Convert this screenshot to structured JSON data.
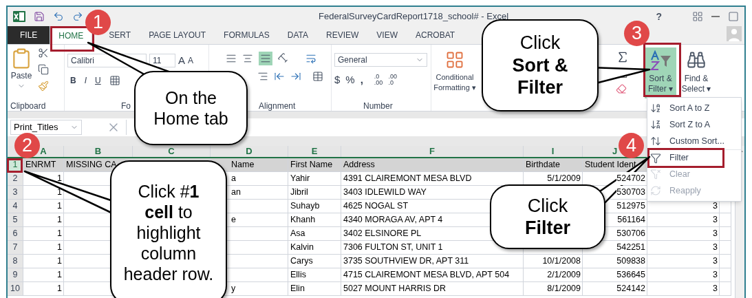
{
  "window": {
    "title": "FederalSurveyCardReport1718_school# - Excel",
    "help": "?"
  },
  "tabs": [
    {
      "label": "FILE",
      "kind": "file",
      "selected": false
    },
    {
      "label": "HOME",
      "kind": "tab",
      "selected": true
    },
    {
      "label": "SERT",
      "kind": "tab",
      "selected": false
    },
    {
      "label": "PAGE LAYOUT",
      "kind": "tab",
      "selected": false
    },
    {
      "label": "FORMULAS",
      "kind": "tab",
      "selected": false
    },
    {
      "label": "DATA",
      "kind": "tab",
      "selected": false
    },
    {
      "label": "REVIEW",
      "kind": "tab",
      "selected": false
    },
    {
      "label": "VIEW",
      "kind": "tab",
      "selected": false
    },
    {
      "label": "ACROBAT",
      "kind": "tab",
      "selected": false
    }
  ],
  "ribbon": {
    "clipboard": {
      "paste": "Paste",
      "label": "Clipboard"
    },
    "font": {
      "name": "Calibri",
      "size": "11",
      "grow": "A",
      "shrink": "A",
      "bold": "B",
      "italic": "I",
      "underline": "U",
      "label": "Fo"
    },
    "alignment": {
      "label": "Alignment"
    },
    "number": {
      "format": "General",
      "currency": "$",
      "percent": "%",
      "comma": ",",
      "increase_decimal": {
        "top": ".0",
        "bottom": ".00"
      },
      "decrease_decimal": {
        "top": ".00",
        "bottom": ".0"
      },
      "label": "Number"
    },
    "styles": {
      "conditional": "Conditional\nFormatting ▾"
    },
    "editing": {
      "sort_filter": "Sort &\nFilter ▾",
      "find_select": "Find &\nSelect ▾"
    }
  },
  "formula_bar": {
    "name_box": "Print_Titles"
  },
  "sheet": {
    "columns": [
      "A",
      "B",
      "C",
      "D",
      "E",
      "F",
      "I",
      "J"
    ],
    "rows": [
      {
        "number": "1",
        "selected": true,
        "cells": [
          "ENRMT",
          "MISSING CA",
          null,
          "Name",
          "First Name",
          "Address",
          "Birthdate",
          "Student Ident",
          null,
          null
        ]
      },
      {
        "number": "2",
        "selected": false,
        "cells": [
          "1",
          null,
          null,
          "a",
          "Yahir",
          "4391 CLAIREMONT MESA BLVD",
          "5/1/2009",
          "524702",
          null,
          null
        ]
      },
      {
        "number": "3",
        "selected": false,
        "cells": [
          "1",
          null,
          null,
          "an",
          "Jibril",
          "3403 IDLEWILD WAY",
          null,
          "530703",
          null,
          null
        ]
      },
      {
        "number": "4",
        "selected": false,
        "cells": [
          "1",
          null,
          null,
          null,
          "Suhayb",
          "4625 NOGAL ST",
          null,
          "512975",
          "3",
          null
        ]
      },
      {
        "number": "5",
        "selected": false,
        "cells": [
          "1",
          null,
          null,
          "e",
          "Khanh",
          "4340 MORAGA AV, APT 4",
          null,
          "561164",
          "3",
          null
        ]
      },
      {
        "number": "6",
        "selected": false,
        "cells": [
          "1",
          null,
          null,
          null,
          "Asa",
          "3402 ELSINORE PL",
          null,
          "530706",
          "3",
          null
        ]
      },
      {
        "number": "7",
        "selected": false,
        "cells": [
          "1",
          null,
          null,
          null,
          "Kalvin",
          "7306 FULTON ST, UNIT 1",
          null,
          "542251",
          "3",
          null
        ]
      },
      {
        "number": "8",
        "selected": false,
        "cells": [
          "1",
          null,
          null,
          null,
          "Carys",
          "3735 SOUTHVIEW DR, APT 311",
          "10/1/2008",
          "509838",
          "3",
          null
        ]
      },
      {
        "number": "9",
        "selected": false,
        "cells": [
          "1",
          null,
          null,
          null,
          "Ellis",
          "4715 CLAIREMONT MESA BLVD, APT 504",
          "2/1/2009",
          "536645",
          "3",
          null
        ]
      },
      {
        "number": "10",
        "selected": false,
        "cells": [
          "1",
          null,
          null,
          "y",
          "Elin",
          "5027 MOUNT HARRIS DR",
          "8/1/2009",
          "524142",
          "3",
          null
        ]
      }
    ]
  },
  "menu": {
    "items": [
      {
        "label": "Sort A to Z",
        "kind": "sort-asc",
        "disabled": false
      },
      {
        "label": "Sort Z to A",
        "kind": "sort-desc",
        "disabled": false
      },
      {
        "label": "Custom Sort...",
        "kind": "custom",
        "disabled": false
      },
      {
        "label": "Filter",
        "kind": "filter",
        "disabled": false
      },
      {
        "label": "Clear",
        "kind": "clear",
        "disabled": true
      },
      {
        "label": "Reapply",
        "kind": "reapply",
        "disabled": true
      }
    ]
  },
  "steps": [
    "1",
    "3",
    "2",
    "4"
  ],
  "callouts": [
    {
      "text": "On the\nHome tab"
    },
    {
      "text": "Click #**1**\n**cell** to\nhighlight\ncolumn\nheader row."
    },
    {
      "text": "Click\n**Sort &**\n**Filter**"
    },
    {
      "text": "Click\n**Filter**"
    }
  ]
}
